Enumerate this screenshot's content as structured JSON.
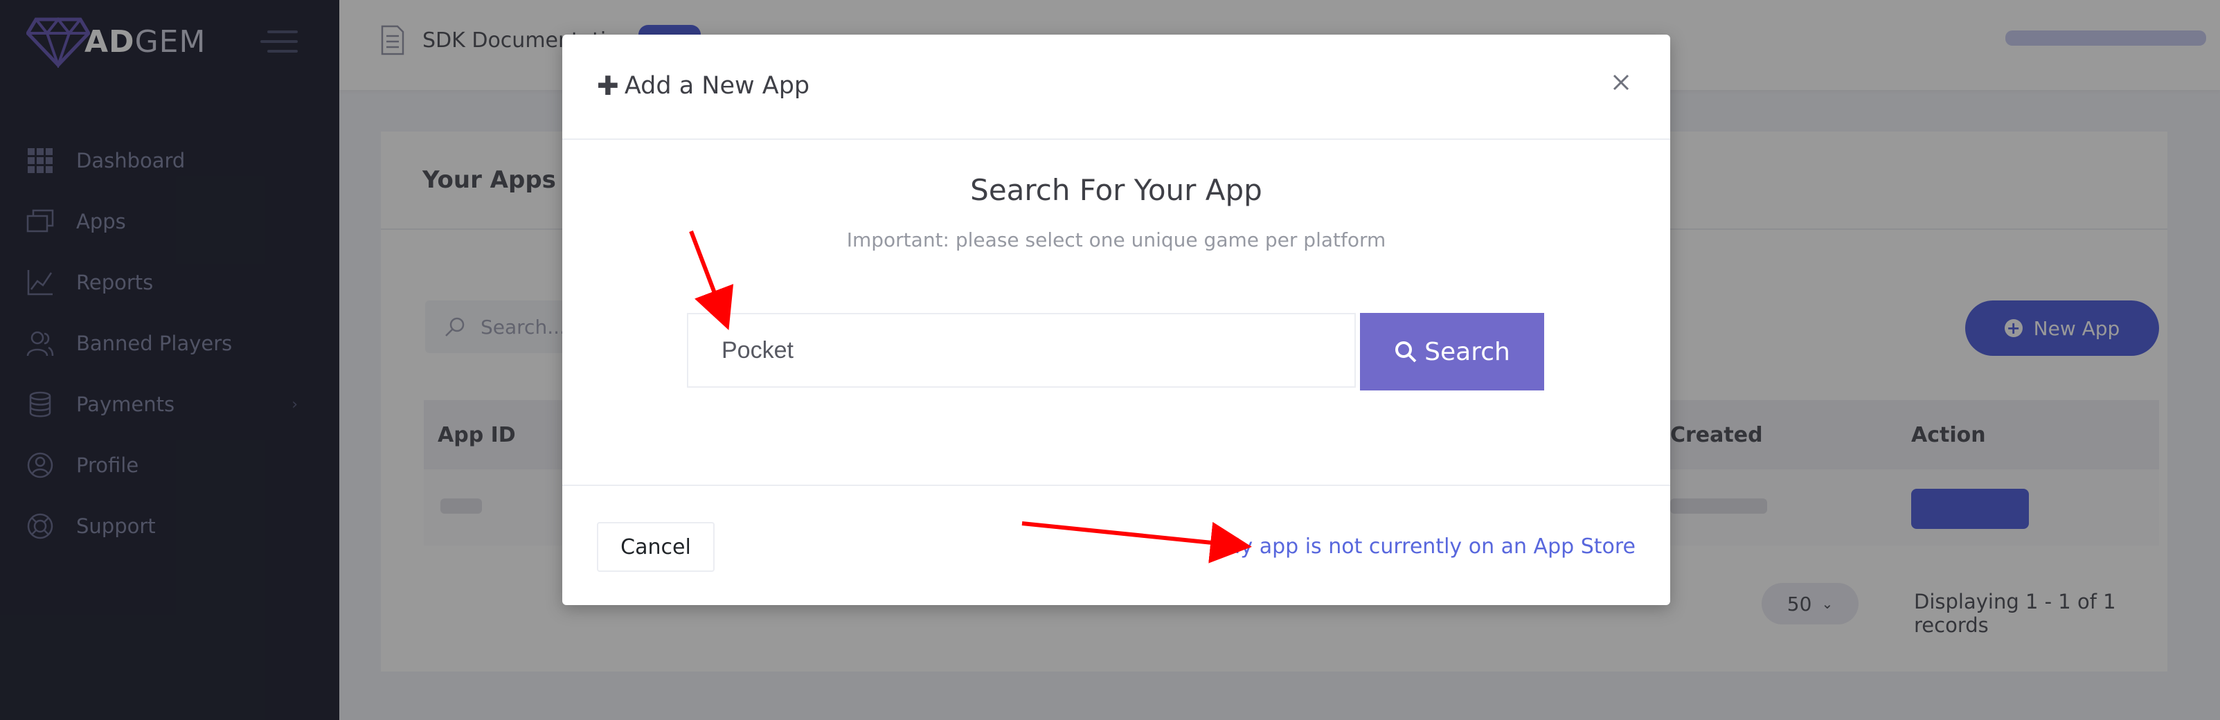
{
  "brand": {
    "logo_prefix": "AD",
    "logo_suffix": "GEM"
  },
  "sidebar": {
    "items": [
      {
        "label": "Dashboard",
        "icon": "grid-icon"
      },
      {
        "label": "Apps",
        "icon": "apps-icon"
      },
      {
        "label": "Reports",
        "icon": "chart-icon"
      },
      {
        "label": "Banned Players",
        "icon": "users-icon"
      },
      {
        "label": "Payments",
        "icon": "coins-icon",
        "chevron": "›"
      },
      {
        "label": "Profile",
        "icon": "profile-icon"
      },
      {
        "label": "Support",
        "icon": "lifebuoy-icon"
      }
    ]
  },
  "topbar": {
    "doc_label": "SDK Documentation"
  },
  "content": {
    "title": "Your Apps",
    "search_placeholder": "Search...",
    "new_app_label": "New App",
    "new_app_plus": "+",
    "table": {
      "headers": {
        "app_id": "App ID",
        "created": "Created",
        "action": "Action"
      }
    },
    "page_size": "50",
    "page_size_chevron": "⌄",
    "records_text": "Displaying 1 - 1 of 1 records"
  },
  "modal": {
    "title_plus": "✚",
    "title": "Add a New App",
    "heading": "Search For Your App",
    "subtitle": "Important: please select one unique game per platform",
    "search_value": "Pocket",
    "search_button": "Search",
    "cancel_label": "Cancel",
    "not_on_store_link": "My app is not currently on an App Store"
  },
  "colors": {
    "accent": "#716aca",
    "brand": "#5867dd",
    "sidebar": "#2c2e3e",
    "annotation": "#ff0000"
  }
}
